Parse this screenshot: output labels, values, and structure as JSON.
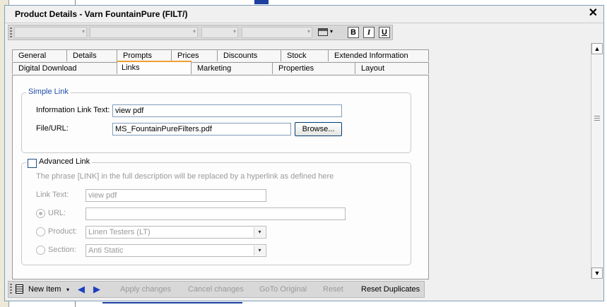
{
  "window": {
    "title": "Product Details - Varn FountainPure (FILT/)",
    "close_glyph": "✕"
  },
  "format_toolbar": {
    "bold": "B",
    "italic": "I",
    "underline": "U"
  },
  "tabs": {
    "row1": [
      "General",
      "Details",
      "Prompts",
      "Prices",
      "Discounts",
      "Stock",
      "Extended Information"
    ],
    "row2": [
      "Digital Download",
      "Links",
      "Marketing",
      "Properties",
      "Layout"
    ],
    "active": "Links"
  },
  "simple_link": {
    "legend": "Simple Link",
    "info_label": "Information Link Text:",
    "info_value": "view pdf",
    "file_label": "File/URL:",
    "file_value": "MS_FountainPureFilters.pdf",
    "browse": "Browse..."
  },
  "advanced_link": {
    "legend": "Advanced Link",
    "checked": false,
    "description": "The phrase [LINK] in the full description will be replaced by a hyperlink as defined here",
    "link_text_label": "Link Text:",
    "link_text_value": "view pdf",
    "url_label": "URL:",
    "url_value": "",
    "product_label": "Product:",
    "product_value": "Linen Testers (LT)",
    "section_label": "Section:",
    "section_value": "Anti Static"
  },
  "bottom_toolbar": {
    "new_item": "New Item",
    "apply": "Apply changes",
    "cancel": "Cancel changes",
    "goto": "GoTo Original",
    "reset": "Reset",
    "reset_duplicates": "Reset Duplicates"
  },
  "icons": {
    "dropdown": "▾",
    "prev": "◀",
    "next": "▶",
    "scroll_up": "▲",
    "scroll_down": "▼"
  }
}
